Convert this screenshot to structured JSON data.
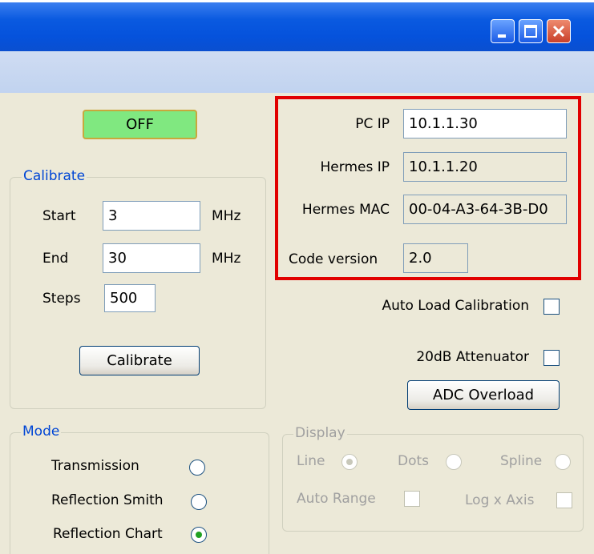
{
  "power_button": {
    "label": "OFF",
    "color": "#80e880"
  },
  "calibrate": {
    "legend": "Calibrate",
    "start_label": "Start",
    "start_value": "3",
    "start_unit": "MHz",
    "end_label": "End",
    "end_value": "30",
    "end_unit": "MHz",
    "steps_label": "Steps",
    "steps_value": "500",
    "button_label": "Calibrate"
  },
  "network": {
    "pc_ip_label": "PC IP",
    "pc_ip_value": "10.1.1.30",
    "hermes_ip_label": "Hermes IP",
    "hermes_ip_value": "10.1.1.20",
    "hermes_mac_label": "Hermes MAC",
    "hermes_mac_value": "00-04-A3-64-3B-D0",
    "code_version_label": "Code version",
    "code_version_value": "2.0"
  },
  "options": {
    "auto_load_label": "Auto Load Calibration",
    "auto_load_checked": false,
    "attenuator_label": "20dB Attenuator",
    "attenuator_checked": false,
    "adc_overload_label": "ADC Overload"
  },
  "mode": {
    "legend": "Mode",
    "options": [
      {
        "label": "Transmission",
        "selected": false
      },
      {
        "label": "Reflection Smith",
        "selected": false
      },
      {
        "label": "Reflection Chart",
        "selected": true
      }
    ]
  },
  "display": {
    "legend": "Display",
    "line_label": "Line",
    "dots_label": "Dots",
    "spline_label": "Spline",
    "selected": "Line",
    "auto_range_label": "Auto Range",
    "log_x_label": "Log x Axis"
  },
  "colors": {
    "titlebar": "#0a5ae0",
    "highlight_box": "#e10000",
    "legend_text": "#0046d5"
  }
}
